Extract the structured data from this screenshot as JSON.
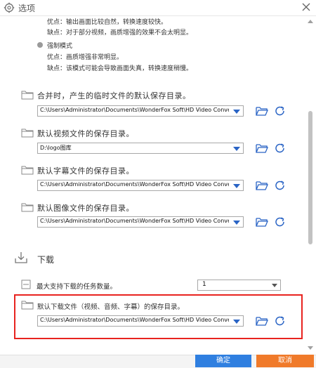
{
  "window": {
    "title": "选项"
  },
  "mode_normal": {
    "advantage": "优点：输出画面比较自然，转换速度较快。",
    "disadvantage": "缺点：对于部分视频，画质增强的效果不会太明显。"
  },
  "mode_force": {
    "label": "强制模式",
    "advantage": "优点：画质增强非常明显。",
    "disadvantage": "缺点：该模式可能会导致画面失真，转换速度稍慢。"
  },
  "folders": [
    {
      "label": "合并时，产生的临时文件的默认保存目录。",
      "path": "C:\\Users\\Administrator\\Documents\\WonderFox Soft\\HD Video Converter Fact"
    },
    {
      "label": "默认视频文件的保存目录。",
      "path": "D:\\logo图库"
    },
    {
      "label": "默认字幕文件的保存目录。",
      "path": "C:\\Users\\Administrator\\Documents\\WonderFox Soft\\HD Video Converter Fact"
    },
    {
      "label": "默认图像文件的保存目录。",
      "path": "C:\\Users\\Administrator\\Documents\\WonderFox Soft\\HD Video Converter Fact"
    }
  ],
  "download": {
    "title": "下载",
    "max_tasks_label": "最大支持下载的任务数量。",
    "max_tasks_value": "1",
    "folder_label": "默认下载文件（视频、音频、字幕）的保存目录。",
    "folder_path": "C:\\Users\\Administrator\\Documents\\WonderFox Soft\\HD Video Converter Fact"
  },
  "buttons": {
    "ok": "确定",
    "cancel": "取消"
  },
  "colors": {
    "accent": "#2a64c5",
    "ok": "#2f7fe0",
    "cancel": "#f07a2a",
    "highlight": "#e8231f"
  }
}
